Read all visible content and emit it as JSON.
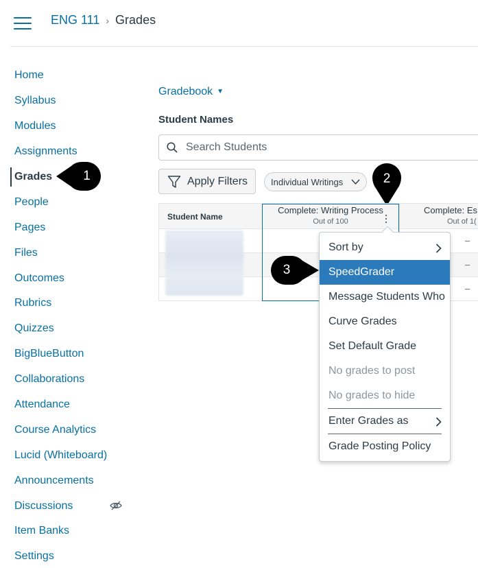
{
  "header": {
    "course": "ENG 111",
    "separator": "›",
    "current": "Grades"
  },
  "sidebar": {
    "items": [
      {
        "label": "Home"
      },
      {
        "label": "Syllabus"
      },
      {
        "label": "Modules"
      },
      {
        "label": "Assignments"
      },
      {
        "label": "Grades",
        "active": true
      },
      {
        "label": "People"
      },
      {
        "label": "Pages"
      },
      {
        "label": "Files"
      },
      {
        "label": "Outcomes"
      },
      {
        "label": "Rubrics"
      },
      {
        "label": "Quizzes"
      },
      {
        "label": "BigBlueButton"
      },
      {
        "label": "Collaborations"
      },
      {
        "label": "Attendance"
      },
      {
        "label": "Course Analytics"
      },
      {
        "label": "Lucid (Whiteboard)"
      },
      {
        "label": "Announcements"
      },
      {
        "label": "Discussions",
        "hidden_icon": "eye-slash-icon"
      },
      {
        "label": "Item Banks"
      },
      {
        "label": "Settings"
      }
    ]
  },
  "callouts": [
    "1",
    "2",
    "3"
  ],
  "main": {
    "gradebook_label": "Gradebook",
    "gradebook_caret": "▼",
    "student_names_label": "Student Names",
    "search_placeholder": "Search Students",
    "apply_filters_label": "Apply Filters",
    "filter_pill_label": "Individual Writings"
  },
  "grid": {
    "student_col": "Student Name",
    "columns": [
      {
        "title": "Complete: Writing Process",
        "subtitle": "Out of 100"
      },
      {
        "title": "Complete: Es",
        "subtitle": "Out of 1("
      }
    ],
    "dash": "–"
  },
  "menu": {
    "items": [
      {
        "label": "Sort by",
        "submenu": true
      },
      {
        "label": "SpeedGrader",
        "selected": true
      },
      {
        "label": "Message Students Who"
      },
      {
        "label": "Curve Grades"
      },
      {
        "label": "Set Default Grade"
      },
      {
        "label": "No grades to post",
        "disabled": true
      },
      {
        "label": "No grades to hide",
        "disabled": true
      },
      {
        "label": "Enter Grades as",
        "submenu": true
      },
      {
        "label": "Grade Posting Policy"
      }
    ]
  },
  "colors": {
    "link": "#0770a3",
    "text": "#2d3b45",
    "selected": "#2b7abc",
    "callout": "#000000"
  }
}
